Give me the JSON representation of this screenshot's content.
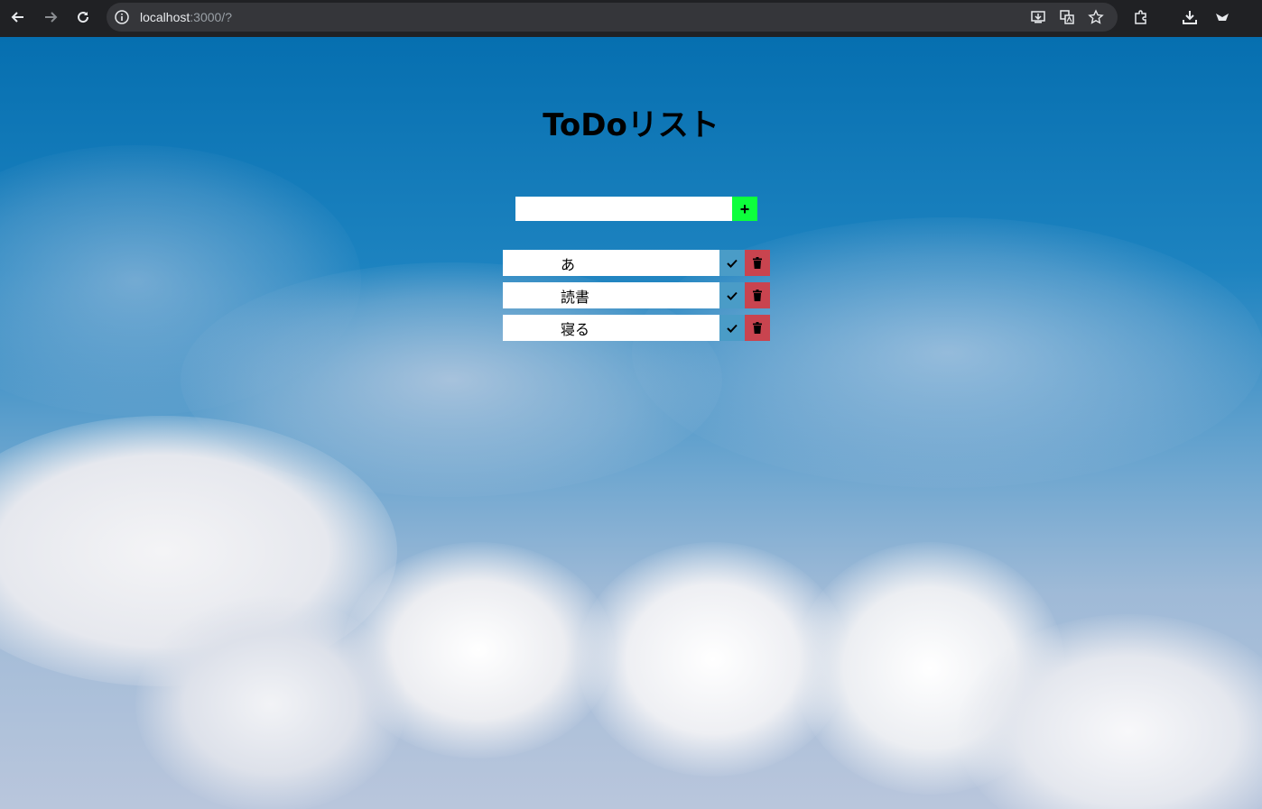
{
  "browser": {
    "url_host": "localhost",
    "url_rest": ":3000/?",
    "icons": [
      "back-icon",
      "forward-icon",
      "reload-icon",
      "site-info-icon",
      "install-icon",
      "translate-icon",
      "bookmark-star-icon",
      "extensions-icon",
      "download-icon",
      "profile-icon"
    ]
  },
  "app": {
    "title": "ToDoリスト",
    "new_todo": {
      "value": "",
      "placeholder": ""
    },
    "add_label": "+",
    "todos": [
      {
        "text": "あ"
      },
      {
        "text": "読書"
      },
      {
        "text": "寝る"
      }
    ]
  },
  "colors": {
    "add_button": "#0dff3c",
    "done_button": "#4a9cc7",
    "delete_button": "#c9444f"
  }
}
